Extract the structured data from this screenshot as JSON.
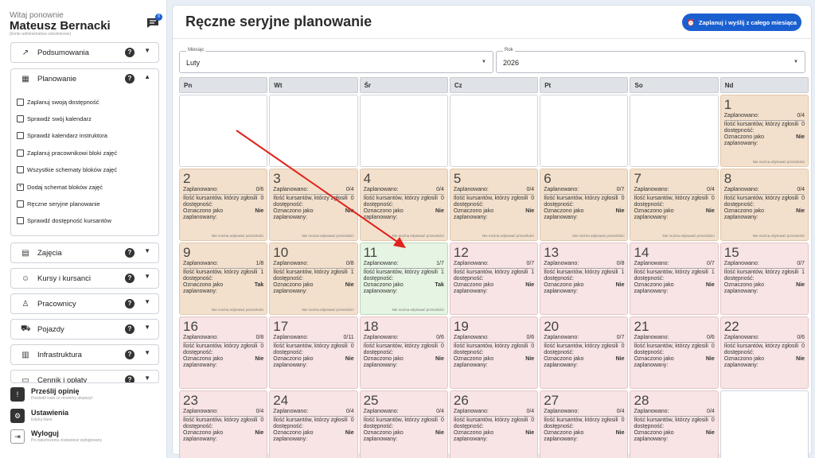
{
  "user": {
    "welcome": "Witaj ponownie",
    "name": "Mateusz Bernacki",
    "role": "(konto administratora szkoleniowe)",
    "notif_count": "0"
  },
  "nav": {
    "podsumowania": "Podsumowania",
    "planowanie": "Planowanie",
    "planowanie_items": [
      "Zaplanuj swoją dostępność",
      "Sprawdź swój kalendarz",
      "Sprawdź kalendarz instruktora",
      "Zaplanuj pracownikowi bloki zajęć",
      "Wszystkie schematy bloków zajęć",
      "Dodaj schemat bloków zajęć",
      "Ręczne seryjne planowanie",
      "Sprawdź dostępność kursantów"
    ],
    "zajecia": "Zajęcia",
    "kursy": "Kursy i kursanci",
    "pracownicy": "Pracownicy",
    "pojazdy": "Pojazdy",
    "infrastruktura": "Infrastruktura",
    "cennik": "Cennik i opłaty",
    "help": "?"
  },
  "bottom": {
    "feedback_title": "Prześlij opinię",
    "feedback_sub": "Powiedź nam co możemy ulepszyć",
    "settings_title": "Ustawienia",
    "settings_sub": "Edytuj dane",
    "logout_title": "Wyloguj",
    "logout_sub": "Po zakończeniu zostaniesz wylogowany"
  },
  "page": {
    "title": "Ręczne seryjne planowanie",
    "plan_button": "Zaplanuj i wyślij z całego miesiąca"
  },
  "filters": {
    "month_label": "Miesiąc",
    "month_value": "Luty",
    "year_label": "Rok",
    "year_value": "2026"
  },
  "labels": {
    "planned": "Zaplanowano:",
    "students": "Ilość kursantów, którzy zgłosili dostępność:",
    "marked": "Oznaczono jako zaplanowany:",
    "no_edit": "Nie można edytować przeszłości"
  },
  "weekdays": [
    "Pn",
    "Wt",
    "Śr",
    "Cz",
    "Pt",
    "So",
    "Nd"
  ],
  "days": [
    null,
    null,
    null,
    null,
    null,
    null,
    {
      "d": "1",
      "planned": "0/4",
      "students": "0",
      "marked": "Nie",
      "state": "past"
    },
    {
      "d": "2",
      "planned": "0/6",
      "students": "0",
      "marked": "Nie",
      "state": "past"
    },
    {
      "d": "3",
      "planned": "0/4",
      "students": "0",
      "marked": "Nie",
      "state": "past"
    },
    {
      "d": "4",
      "planned": "0/4",
      "students": "0",
      "marked": "Nie",
      "state": "past"
    },
    {
      "d": "5",
      "planned": "0/4",
      "students": "0",
      "marked": "Nie",
      "state": "past"
    },
    {
      "d": "6",
      "planned": "0/7",
      "students": "0",
      "marked": "Nie",
      "state": "past"
    },
    {
      "d": "7",
      "planned": "0/4",
      "students": "0",
      "marked": "Nie",
      "state": "past"
    },
    {
      "d": "8",
      "planned": "0/4",
      "students": "0",
      "marked": "Nie",
      "state": "past"
    },
    {
      "d": "9",
      "planned": "1/8",
      "students": "1",
      "marked": "Tak",
      "state": "past"
    },
    {
      "d": "10",
      "planned": "0/8",
      "students": "1",
      "marked": "Nie",
      "state": "past"
    },
    {
      "d": "11",
      "planned": "1/7",
      "students": "1",
      "marked": "Tak",
      "state": "today"
    },
    {
      "d": "12",
      "planned": "0/7",
      "students": "1",
      "marked": "Nie",
      "state": "future"
    },
    {
      "d": "13",
      "planned": "0/8",
      "students": "1",
      "marked": "Nie",
      "state": "future"
    },
    {
      "d": "14",
      "planned": "0/7",
      "students": "1",
      "marked": "Nie",
      "state": "future"
    },
    {
      "d": "15",
      "planned": "0/7",
      "students": "1",
      "marked": "Nie",
      "state": "future"
    },
    {
      "d": "16",
      "planned": "0/8",
      "students": "0",
      "marked": "Nie",
      "state": "future"
    },
    {
      "d": "17",
      "planned": "0/11",
      "students": "0",
      "marked": "Nie",
      "state": "future"
    },
    {
      "d": "18",
      "planned": "0/6",
      "students": "0",
      "marked": "Nie",
      "state": "future"
    },
    {
      "d": "19",
      "planned": "0/6",
      "students": "0",
      "marked": "Nie",
      "state": "future"
    },
    {
      "d": "20",
      "planned": "0/7",
      "students": "0",
      "marked": "Nie",
      "state": "future"
    },
    {
      "d": "21",
      "planned": "0/6",
      "students": "0",
      "marked": "Nie",
      "state": "future"
    },
    {
      "d": "22",
      "planned": "0/6",
      "students": "0",
      "marked": "Nie",
      "state": "future"
    },
    {
      "d": "23",
      "planned": "0/4",
      "students": "0",
      "marked": "Nie",
      "state": "future"
    },
    {
      "d": "24",
      "planned": "0/4",
      "students": "0",
      "marked": "Nie",
      "state": "future"
    },
    {
      "d": "25",
      "planned": "0/4",
      "students": "0",
      "marked": "Nie",
      "state": "future"
    },
    {
      "d": "26",
      "planned": "0/4",
      "students": "0",
      "marked": "Nie",
      "state": "future"
    },
    {
      "d": "27",
      "planned": "0/4",
      "students": "0",
      "marked": "Nie",
      "state": "future"
    },
    {
      "d": "28",
      "planned": "0/4",
      "students": "0",
      "marked": "Nie",
      "state": "future"
    },
    null
  ],
  "colors": {
    "accent": "#1a5fd0",
    "past": "#f3e0cc",
    "today": "#e6f4e3",
    "future": "#f8e4e4",
    "arrow": "#e0231c"
  }
}
